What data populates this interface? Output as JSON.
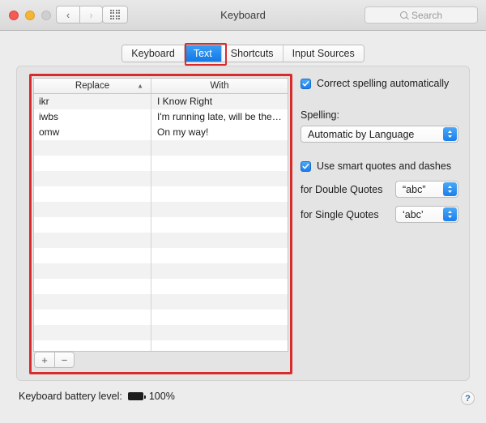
{
  "window": {
    "title": "Keyboard",
    "traffic_lights": [
      "close",
      "minimize",
      "zoom"
    ],
    "nav": {
      "back": "‹",
      "forward": "›"
    },
    "show_all_icon": "grid-icon"
  },
  "search": {
    "placeholder": "Search",
    "icon": "search-icon"
  },
  "tabs": [
    {
      "label": "Keyboard",
      "active": false
    },
    {
      "label": "Text",
      "active": true
    },
    {
      "label": "Shortcuts",
      "active": false
    },
    {
      "label": "Input Sources",
      "active": false
    }
  ],
  "table": {
    "columns": [
      "Replace",
      "With"
    ],
    "sort_indicator": "▲",
    "sort_column": "Replace",
    "sort_direction": "ascending",
    "rows": [
      {
        "replace": "ikr",
        "with": "I Know Right"
      },
      {
        "replace": "iwbs",
        "with": "I'm running late, will be the…"
      },
      {
        "replace": "omw",
        "with": "On my way!"
      }
    ],
    "empty_row_count": 15
  },
  "table_buttons": {
    "add": "+",
    "remove": "−"
  },
  "options": {
    "correct_spelling": {
      "label": "Correct spelling automatically",
      "checked": true
    },
    "spelling": {
      "label": "Spelling:",
      "value": "Automatic by Language"
    },
    "smart_quotes": {
      "label": "Use smart quotes and dashes",
      "checked": true
    },
    "double_quotes": {
      "label": "for Double Quotes",
      "value": "“abc”"
    },
    "single_quotes": {
      "label": "for Single Quotes",
      "value": "‘abc’"
    }
  },
  "status": {
    "battery_label": "Keyboard battery level:",
    "battery_percent": "100%",
    "battery_icon": "battery-full-icon",
    "help": "?"
  },
  "annotations": {
    "accent_red": "#d92b2b",
    "accent_blue": "#1a7fec"
  }
}
